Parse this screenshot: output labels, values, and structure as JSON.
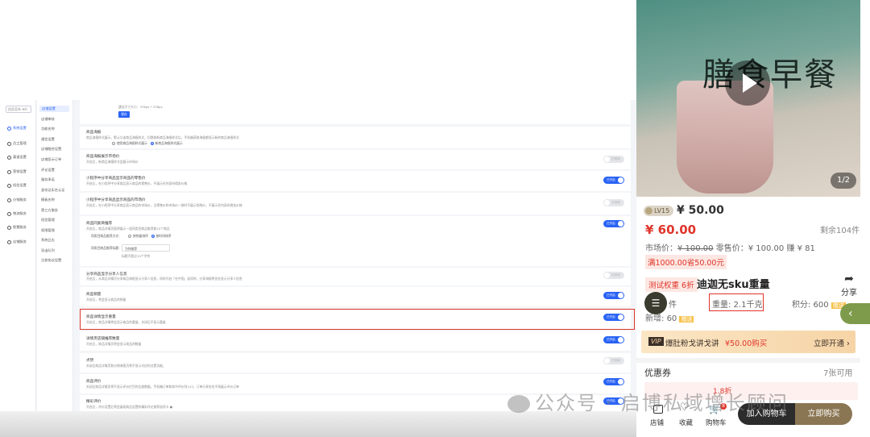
{
  "admin": {
    "search_placeholder": "搜索菜单 ⌘K",
    "nav1": [
      {
        "label": "系统设置",
        "active": true
      },
      {
        "label": "员工管理"
      },
      {
        "label": "渠道设置"
      },
      {
        "label": "营销设置"
      },
      {
        "label": "短信设置"
      },
      {
        "label": "分销服务"
      },
      {
        "label": "物流服务"
      },
      {
        "label": "智慧服务"
      },
      {
        "label": "店铺服务"
      }
    ],
    "nav2": [
      {
        "label": "店铺设置",
        "active": true
      },
      {
        "label": "店铺审核"
      },
      {
        "label": "功能名称"
      },
      {
        "label": "通信设置"
      },
      {
        "label": "店铺融合设置"
      },
      {
        "label": "店铺显示订单"
      },
      {
        "label": "评论设置"
      },
      {
        "label": "服务承诺"
      },
      {
        "label": "身份证实名认证"
      },
      {
        "label": "模板名称"
      },
      {
        "label": "第三方服务"
      },
      {
        "label": "短信管理"
      },
      {
        "label": "权限管理"
      },
      {
        "label": "系统日志"
      },
      {
        "label": "导出队列"
      },
      {
        "label": "注册协议设置"
      }
    ],
    "top_hint": "建议尺寸大小：376px * 376px",
    "top_button": "保存",
    "toggle_on_label": "已开启",
    "toggle_off_label": "已关闭",
    "sections": [
      {
        "title": "商品海报",
        "desc": "商品海报样式展示，默认与该商品海报样式，切换前新商品海报样式后，手机端获取海报都显示新的商品海报样式",
        "options": [
          "使用商品海报样式展示",
          "新商品海报样式展示"
        ]
      },
      {
        "title": "商品海报展示市场价",
        "desc": "开启后，新商品海报样式会展示市场价",
        "state": "off"
      },
      {
        "title": "小程序中分享商品显示商品的零售价",
        "desc": "开启后，在小程序中分享商品显示商品的零售价，不展示任何身份佣金价格",
        "state": "on"
      },
      {
        "title": "小程序中分享商品显示商品的市场价",
        "desc": "开启后，在小程序中分享商品显示商品的市场价，当零售价和市场价一致时不展示划线价，不展示任何身份佣金价格",
        "state": "off"
      },
      {
        "title": "商品同类目推荐",
        "desc": "开启后，商品详情页面将展示一组同类目商品推荐前10个商品",
        "state": "on",
        "sub_label1": "同类目商品推荐方式：",
        "sub_options": [
          "按销量排序",
          "按时间排序"
        ],
        "sub_label2": "同类目商品推荐标题：",
        "sub_value": "为你推荐",
        "sub_hint": "标题不超过10个字符"
      },
      {
        "title": "分享商品显示分享人信息",
        "desc": "开启后，从商品详情页分享商品海报显示分享人信息，同时开启「在中国」选项时，分享海报将优先显示分享人信息",
        "state": "off"
      },
      {
        "title": "商品销量",
        "desc": "开启后，将会显示商品的销量",
        "state": "on"
      },
      {
        "title": "商品详情显示重量",
        "desc": "开启后，商品详情将会显示商品的重量，关闭后不显示重量",
        "state": "on"
      },
      {
        "title": "详情页店铺推荐数量",
        "desc": "开启后，商品详情页将会显示商品的数量",
        "state": "on"
      },
      {
        "title": "点赞",
        "desc": "关闭后商品详情页和分销海报页将不显示对应的点赞功能。",
        "state": "off"
      },
      {
        "title": "商品评价",
        "desc": "关闭后商品详情页将不显示评价栏目的全部数据。手机端订单和其中评价列入口，订单分享处也不再展示评价订单",
        "state": "on"
      },
      {
        "title": "精彩评价",
        "desc": "开启后，评价设置后将会展现商品设置的精彩评论推荐选项卡 ●",
        "state": "on"
      }
    ]
  },
  "product": {
    "pager": "1/2",
    "member_level": "LV15",
    "member_price": "¥ 50.00",
    "price": "¥ 60.00",
    "stock": "剩余104件",
    "market_price_label": "市场价：",
    "market_price": "¥ 100.00",
    "retail_price_label": "零售价：",
    "retail_price": "¥ 100.00",
    "save_label": "赚 ¥ 81",
    "coupon_tag": "满1000.00省50.00元",
    "discount_tag": "测试权重 6折",
    "name": "迪迦无sku重量",
    "share_label": "分享",
    "sales_left": "件",
    "weight_label": "重量: 2.1千克",
    "points_label": "积分: 600",
    "redeem_tag": "赠送",
    "bonus_prefix": "新增:",
    "bonus_value": "60",
    "bonus_tag": "赠送",
    "vip_badge": "VIP",
    "vip_text": "爆肚粉戈讲戈讲",
    "vip_price": "¥50.00购买",
    "vip_action": "立即开通 ›",
    "coupon_title": "优惠券",
    "coupon_count": "7张可用",
    "coupon_preview": "1.8折",
    "hero_title": "膳食早餐",
    "side_arrow": "‹",
    "tabs": [
      {
        "label": "店铺"
      },
      {
        "label": "收藏"
      },
      {
        "label": "购物车"
      }
    ],
    "cart_badge": "8",
    "add_cart": "加入购物车",
    "buy_now": "立即购买"
  },
  "watermark": "公众号 · 启博私域增长顾问",
  "colors": {
    "accent": "#2a63f5",
    "highlight": "#e0352b",
    "price": "#e0352b",
    "buy": "#8a7653"
  }
}
